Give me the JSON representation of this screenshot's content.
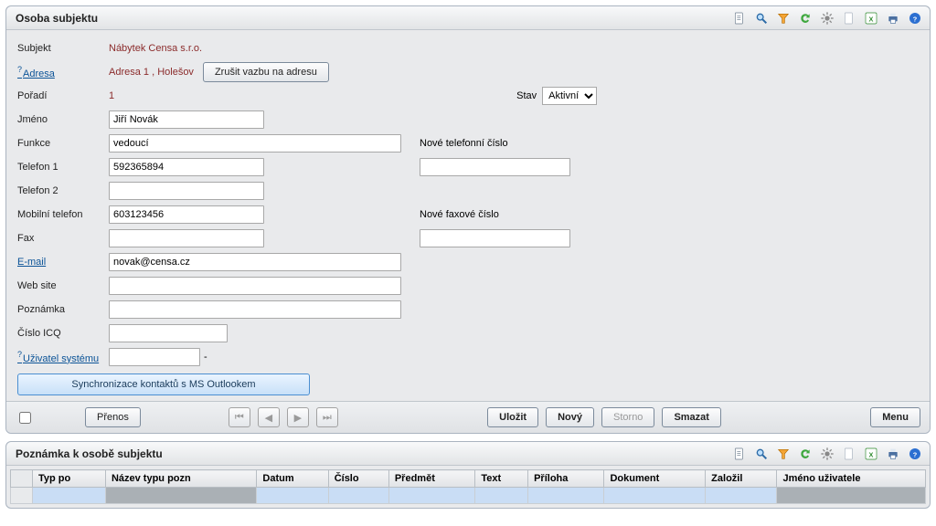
{
  "panel1": {
    "title": "Osoba subjektu",
    "labels": {
      "subjekt": "Subjekt",
      "adresa": "Adresa",
      "poradi": "Pořadí",
      "jmeno": "Jméno",
      "funkce": "Funkce",
      "telefon1": "Telefon 1",
      "telefon2": "Telefon 2",
      "mobil": "Mobilní telefon",
      "fax": "Fax",
      "email": "E-mail",
      "web": "Web site",
      "poznamka": "Poznámka",
      "icq": "Číslo ICQ",
      "uzivatel": "Uživatel systému",
      "stav": "Stav",
      "novy_tel": "Nové telefonní číslo",
      "novy_fax": "Nové faxové číslo"
    },
    "values": {
      "subjekt": "Nábytek Censa s.r.o.",
      "adresa": "Adresa 1 ,  Holešov",
      "poradi": "1",
      "jmeno": "Jiří Novák",
      "funkce": "vedoucí",
      "telefon1": "592365894",
      "telefon2": "",
      "mobil": "603123456",
      "fax": "",
      "email": "novak@censa.cz",
      "web": "",
      "poznamka": "",
      "icq": "",
      "uzivatel": "",
      "uzivatel_suffix": "-",
      "stav_selected": "Aktivní",
      "novy_tel": "",
      "novy_fax": ""
    },
    "buttons": {
      "zrusit_vazbu": "Zrušit vazbu na adresu",
      "sync": "Synchronizace kontaktů s MS Outlookem",
      "prenos": "Přenos",
      "ulozit": "Uložit",
      "novy": "Nový",
      "storno": "Storno",
      "smazat": "Smazat",
      "menu": "Menu"
    }
  },
  "panel2": {
    "title": "Poznámka k osobě subjektu",
    "columns": [
      "Typ po",
      "Název typu pozn",
      "Datum",
      "Číslo",
      "Předmět",
      "Text",
      "Příloha",
      "Dokument",
      "Založil",
      "Jméno uživatele"
    ]
  },
  "icons": {
    "page": "page-icon",
    "search": "search-icon",
    "filter": "filter-icon",
    "refresh": "refresh-icon",
    "gear": "gear-icon",
    "new": "new-page-icon",
    "excel": "excel-icon",
    "print": "print-icon",
    "help": "help-icon"
  }
}
